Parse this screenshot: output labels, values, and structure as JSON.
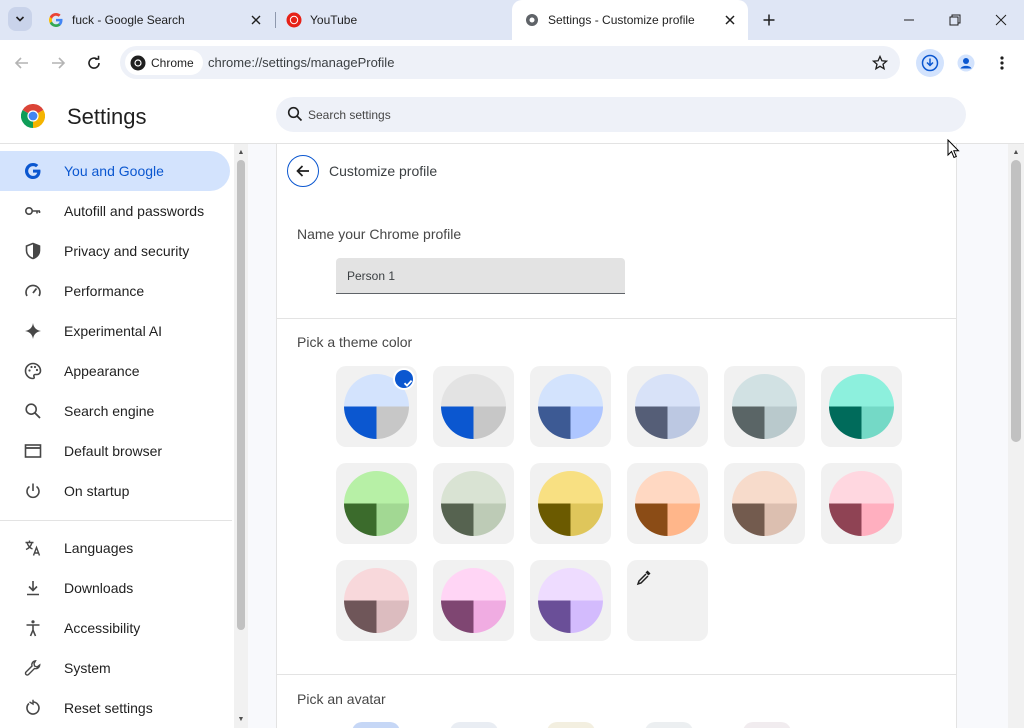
{
  "tabs": [
    {
      "title": "fuck - Google Search",
      "active": false
    },
    {
      "title": "YouTube",
      "active": false
    },
    {
      "title": "Settings - Customize profile",
      "active": true
    }
  ],
  "toolbar": {
    "site_chip": "Chrome",
    "url": "chrome://settings/manageProfile"
  },
  "header": {
    "title": "Settings",
    "search_placeholder": "Search settings"
  },
  "sidebar": {
    "items": [
      {
        "label": "You and Google",
        "icon": "google-g-icon",
        "active": true
      },
      {
        "label": "Autofill and passwords",
        "icon": "key-icon"
      },
      {
        "label": "Privacy and security",
        "icon": "shield-icon"
      },
      {
        "label": "Performance",
        "icon": "speedometer-icon"
      },
      {
        "label": "Experimental AI",
        "icon": "sparkle-icon"
      },
      {
        "label": "Appearance",
        "icon": "palette-icon"
      },
      {
        "label": "Search engine",
        "icon": "search-icon"
      },
      {
        "label": "Default browser",
        "icon": "browser-window-icon"
      },
      {
        "label": "On startup",
        "icon": "power-icon"
      },
      {
        "label": "Languages",
        "icon": "translate-icon"
      },
      {
        "label": "Downloads",
        "icon": "download-icon"
      },
      {
        "label": "Accessibility",
        "icon": "accessibility-icon"
      },
      {
        "label": "System",
        "icon": "wrench-icon"
      },
      {
        "label": "Reset settings",
        "icon": "reset-icon"
      }
    ]
  },
  "main": {
    "page_title": "Customize profile",
    "name_label": "Name your Chrome profile",
    "name_value": "Person 1",
    "theme_label": "Pick a theme color",
    "avatar_label": "Pick an avatar",
    "themes": [
      {
        "bg": "#d3e3fd",
        "dark": "#0b57d0",
        "light": "#c7c7c7",
        "selected": true
      },
      {
        "bg": "#e3e3e3",
        "dark": "#0b57d0",
        "light": "#c7c7c7"
      },
      {
        "bg": "#d3e3fd",
        "dark": "#3d5a94",
        "light": "#aec6ff"
      },
      {
        "bg": "#d8e2f8",
        "dark": "#555e77",
        "light": "#bcc8e2"
      },
      {
        "bg": "#d1e1e3",
        "dark": "#5a6566",
        "light": "#b9c9cc"
      },
      {
        "bg": "#8df0dd",
        "dark": "#006b5b",
        "light": "#74d9c6"
      },
      {
        "bg": "#b7f0a6",
        "dark": "#3b6b2c",
        "light": "#a2d893"
      },
      {
        "bg": "#d9e3d3",
        "dark": "#566350",
        "light": "#bdcbb6"
      },
      {
        "bg": "#f8e082",
        "dark": "#6b5a00",
        "light": "#dfc65b"
      },
      {
        "bg": "#ffd8c2",
        "dark": "#8b4c16",
        "light": "#ffb68a"
      },
      {
        "bg": "#f7dbcb",
        "dark": "#735b4e",
        "light": "#dcbfb0"
      },
      {
        "bg": "#ffd7e0",
        "dark": "#8f4354",
        "light": "#ffafbf"
      },
      {
        "bg": "#f8d8db",
        "dark": "#6f5659",
        "light": "#dcbcbf"
      },
      {
        "bg": "#ffd5f5",
        "dark": "#7f4672",
        "light": "#f0ace2"
      },
      {
        "bg": "#eedcff",
        "dark": "#6a4f98",
        "light": "#d3bbfd"
      }
    ]
  },
  "colors": {
    "accent": "#0b57d0",
    "active_nav_bg": "#d3e3fd",
    "tabstrip_bg": "#dfe6f5",
    "omnibox_bg": "#eef1f8"
  }
}
